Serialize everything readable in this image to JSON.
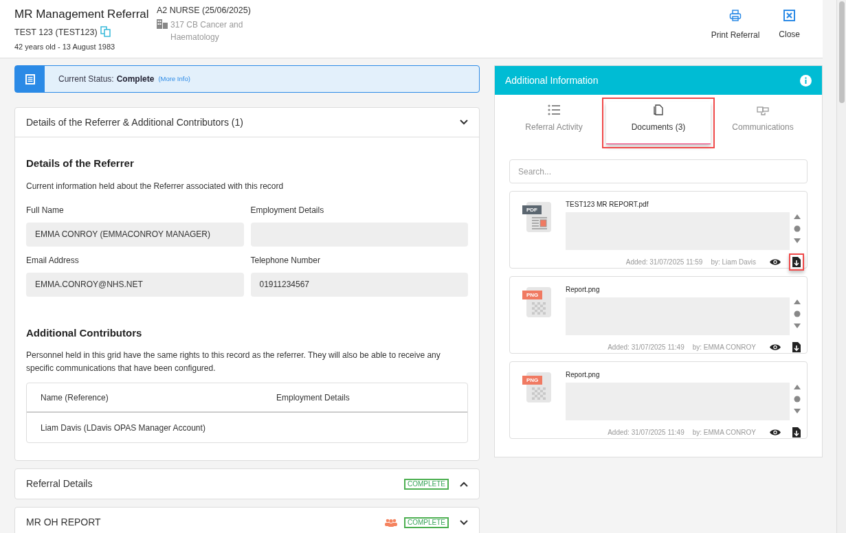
{
  "header": {
    "title": "MR Management Referral",
    "patient": "TEST 123 (TEST123)",
    "age_dob": "42 years old - 13 August 1983",
    "role": "A2 NURSE (25/06/2025)",
    "department": "317 CB Cancer and Haematology",
    "actions": [
      {
        "kind": "print",
        "label": "Print Referral"
      },
      {
        "kind": "close",
        "label": "Close"
      }
    ]
  },
  "status": {
    "label": "Current Status:",
    "value": "Complete",
    "link": "(More Info)"
  },
  "referrer_section": {
    "title": "Details of the Referrer & Additional Contributors (1)",
    "expanded": true,
    "heading": "Details of the Referrer",
    "description": "Current information held about the Referrer associated with this record",
    "fields": [
      {
        "label": "Full Name",
        "value": "EMMA CONROY (EMMACONROY MANAGER)"
      },
      {
        "label": "Employment Details"
      },
      {
        "label": "Email Address",
        "value": "EMMA.CONROY@NHS.NET"
      },
      {
        "label": "Telephone Number",
        "value": "01911234567"
      }
    ],
    "contributors_heading": "Additional Contributors",
    "contributors_description": "Personnel held in this grid have the same rights to this record as the referrer. They will also be able to receive any specific communications that have been configured.",
    "table": {
      "columns": [
        "Name (Reference)",
        "Employment Details"
      ],
      "rows": [
        [
          "Liam Davis (LDavis OPAS Manager Account)",
          ""
        ]
      ]
    }
  },
  "sections": [
    {
      "title": "Referral Details",
      "badge": "COMPLETE",
      "team_icon": false,
      "expanded": false
    },
    {
      "title": "MR OH REPORT",
      "badge": "COMPLETE",
      "team_icon": true,
      "expanded": true
    }
  ],
  "side_panel": {
    "title": "Additional Information",
    "tabs": [
      {
        "kind": "list",
        "label": "Referral Activity",
        "selected": false,
        "highlighted": false
      },
      {
        "kind": "documents",
        "label": "Documents (3)",
        "selected": true,
        "highlighted": true
      },
      {
        "kind": "communications",
        "label": "Communications",
        "selected": false,
        "highlighted": false
      }
    ],
    "search": {
      "placeholder": "Search..."
    },
    "documents": [
      {
        "kind": "pdf",
        "type_label": "PDF",
        "name": "TEST123 MR REPORT.pdf",
        "added": "Added: 31/07/2025 11:59",
        "by": "by: Liam Davis",
        "download_highlighted": true
      },
      {
        "kind": "png",
        "type_label": "PNG",
        "name": "Report.png",
        "added": "Added: 31/07/2025 11:49",
        "by": "by: EMMA CONROY",
        "download_highlighted": false
      },
      {
        "kind": "png",
        "type_label": "PNG",
        "name": "Report.png",
        "added": "Added: 31/07/2025 11:49",
        "by": "by: EMMA CONROY",
        "download_highlighted": false
      }
    ]
  }
}
